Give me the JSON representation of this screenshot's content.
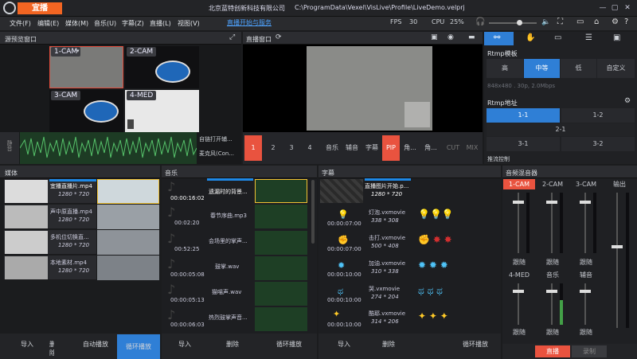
{
  "app": {
    "brand": "宜播",
    "company": "北京蓝特创新科技有限公司",
    "file_path": "C:\\ProgramData\\Vexel\\VisLive\\Profile\\LiveDemo.velprj",
    "live_tip": "直播开始与服务",
    "fps_label": "FPS",
    "fps_value": "30",
    "cpu_label": "CPU",
    "cpu_value": "25%"
  },
  "menu": [
    "文件(F)",
    "编辑(E)",
    "媒体(M)",
    "音乐(U)",
    "字幕(Z)",
    "直播(L)",
    "视图(V)"
  ],
  "source_panel": {
    "title": "源预览窗口",
    "cams": [
      "1-CAM",
      "2-CAM",
      "3-CAM",
      "4-MED"
    ],
    "audio_labels": [
      "自链打开辅...",
      "麦克风(Con..."
    ],
    "mute_label": "静音"
  },
  "live_panel": {
    "title": "直播窗口",
    "buttons": [
      "1",
      "2",
      "3",
      "4",
      "音乐",
      "辅音",
      "字幕",
      "PIP",
      "角...",
      "角...",
      "CUT",
      "MIX"
    ]
  },
  "rtmp": {
    "template_title": "Rtmp模板",
    "qualities": [
      "高",
      "中等",
      "低",
      "自定义"
    ],
    "active_quality": "中等",
    "spec": "848x480 . 30p, 2.0Mbps",
    "address_title": "Rtmp地址",
    "addresses": [
      "1-1",
      "1-2",
      "2-1",
      "3-1",
      "3-2"
    ],
    "record_title": "推流控制"
  },
  "media": {
    "title": "媒体",
    "items": [
      {
        "name": "宜播直播片.mp4",
        "res": "1280 * 720"
      },
      {
        "name": "声中原直播.mp4",
        "res": "1280 * 720"
      },
      {
        "name": "多机位切换直...",
        "res": "1280 * 720"
      },
      {
        "name": "本地素材.mp4",
        "res": "1280 * 720"
      }
    ],
    "footer": [
      "导入",
      "删除",
      "自动播放",
      "循环播放"
    ]
  },
  "music": {
    "title": "音乐",
    "items": [
      {
        "time": "00:00:16:02",
        "name": "遗漏时的背景..."
      },
      {
        "time": "00:02:20",
        "name": "春节序曲.mp3"
      },
      {
        "time": "00:52:25",
        "name": "会场里的掌声..."
      },
      {
        "time": "00:00:05:08",
        "name": "鼓掌.wav"
      },
      {
        "time": "00:00:05:13",
        "name": "猫喵声.wav"
      },
      {
        "time": "00:00:06:03",
        "name": "热烈鼓掌声音..."
      }
    ],
    "footer": [
      "导入",
      "删除",
      "循环播放"
    ]
  },
  "subtitles": {
    "title": "字幕",
    "items": [
      {
        "time": "",
        "name": "直播图片开始.p...",
        "res": "1280 * 720"
      },
      {
        "time": "00:00:07:00",
        "name": "灯泡.vxmovie",
        "res": "338 * 308"
      },
      {
        "time": "00:00:07:00",
        "name": "击打.vxmovie",
        "res": "500 * 408"
      },
      {
        "time": "00:00:10:00",
        "name": "加油.vxmovie",
        "res": "310 * 338"
      },
      {
        "time": "00:00:10:00",
        "name": "哭.vxmovie",
        "res": "274 * 204"
      },
      {
        "time": "00:00:10:00",
        "name": "酷耶.vxmovie",
        "res": "314 * 206"
      }
    ],
    "footer": [
      "导入",
      "删除",
      "循环播放"
    ]
  },
  "mixer": {
    "title": "音频混音器",
    "top_channels": [
      "1-CAM",
      "2-CAM",
      "3-CAM",
      "输出"
    ],
    "bottom_channels": [
      "4-MED",
      "音乐",
      "辅音"
    ],
    "follow_labels": [
      "跟随",
      "跟随",
      "跟随",
      "跟随",
      "跟随",
      "跟随"
    ],
    "live_label": "直播",
    "record_label": "录制"
  },
  "colors": {
    "accent": "#e9533f",
    "blue": "#1e88e5",
    "brand": "#f26522"
  }
}
